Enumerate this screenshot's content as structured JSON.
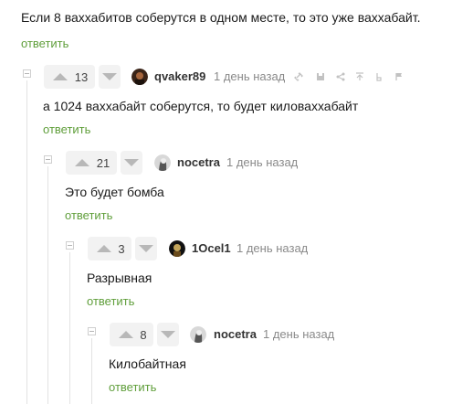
{
  "top": {
    "text": "Если 8 ваххабитов соберутся в одном месте, то это уже ваххабайт.",
    "reply": "ответить"
  },
  "comments": [
    {
      "rating": "13",
      "nick": "qvaker89",
      "time": "1 день назад",
      "text": "а 1024 ваххабайт соберутся, то будет киловаххабайт",
      "reply": "ответить"
    },
    {
      "rating": "21",
      "nick": "nocetra",
      "time": "1 день назад",
      "text": "Это будет бомба",
      "reply": "ответить"
    },
    {
      "rating": "3",
      "nick": "1Ocel1",
      "time": "1 день назад",
      "text": "Разрывная",
      "reply": "ответить"
    },
    {
      "rating": "8",
      "nick": "nocetra",
      "time": "1 день назад",
      "text": "Килобайтная",
      "reply": "ответить"
    }
  ],
  "toolbar_icons": [
    "link-icon",
    "save-icon",
    "share-icon",
    "pin-icon",
    "award-icon",
    "flag-icon"
  ],
  "colors": {
    "reply": "#5f9e3a",
    "thread_line": "#e3e3e3",
    "vote_bg": "#f2f2f2"
  }
}
